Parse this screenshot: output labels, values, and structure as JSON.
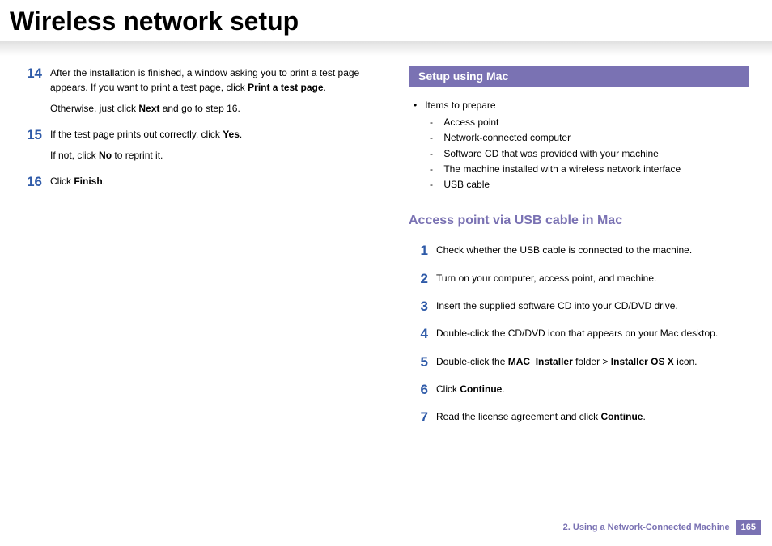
{
  "title": "Wireless network setup",
  "left": {
    "steps": [
      {
        "num": "14",
        "paras": [
          [
            {
              "t": "After the installation is finished, a window asking you to print a test page appears. If you want to print a test page, click "
            },
            {
              "t": "Print a test page",
              "b": true
            },
            {
              "t": "."
            }
          ],
          [
            {
              "t": "Otherwise, just click "
            },
            {
              "t": "Next",
              "b": true
            },
            {
              "t": " and go to step 16."
            }
          ]
        ]
      },
      {
        "num": "15",
        "paras": [
          [
            {
              "t": "If the test page prints out correctly, click "
            },
            {
              "t": "Yes",
              "b": true
            },
            {
              "t": "."
            }
          ],
          [
            {
              "t": "If not, click "
            },
            {
              "t": "No",
              "b": true
            },
            {
              "t": " to reprint it."
            }
          ]
        ]
      },
      {
        "num": "16",
        "paras": [
          [
            {
              "t": "Click "
            },
            {
              "t": "Finish",
              "b": true
            },
            {
              "t": "."
            }
          ]
        ]
      }
    ]
  },
  "right": {
    "section_header": "Setup using Mac",
    "prep_label": "Items to prepare",
    "prep_items": [
      "Access point",
      "Network-connected computer",
      "Software CD that was provided with your machine",
      "The machine installed with a wireless network interface",
      "USB cable"
    ],
    "subheading": "Access point via USB cable in Mac",
    "steps": [
      {
        "num": "1",
        "paras": [
          [
            {
              "t": "Check whether the USB cable is connected to the machine."
            }
          ]
        ]
      },
      {
        "num": "2",
        "paras": [
          [
            {
              "t": "Turn on your computer, access point, and machine."
            }
          ]
        ]
      },
      {
        "num": "3",
        "paras": [
          [
            {
              "t": "Insert the supplied software CD into your CD/DVD drive."
            }
          ]
        ]
      },
      {
        "num": "4",
        "paras": [
          [
            {
              "t": "Double-click the CD/DVD icon that appears on your Mac desktop."
            }
          ]
        ]
      },
      {
        "num": "5",
        "paras": [
          [
            {
              "t": "Double-click the "
            },
            {
              "t": "MAC_Installer",
              "b": true
            },
            {
              "t": " folder > "
            },
            {
              "t": "Installer OS X",
              "b": true
            },
            {
              "t": " icon."
            }
          ]
        ]
      },
      {
        "num": "6",
        "paras": [
          [
            {
              "t": "Click "
            },
            {
              "t": "Continue",
              "b": true
            },
            {
              "t": "."
            }
          ]
        ]
      },
      {
        "num": "7",
        "paras": [
          [
            {
              "t": "Read the license agreement and click "
            },
            {
              "t": "Continue",
              "b": true
            },
            {
              "t": "."
            }
          ]
        ]
      }
    ]
  },
  "footer": {
    "chapter": "2.  Using a Network-Connected Machine",
    "page": "165"
  }
}
